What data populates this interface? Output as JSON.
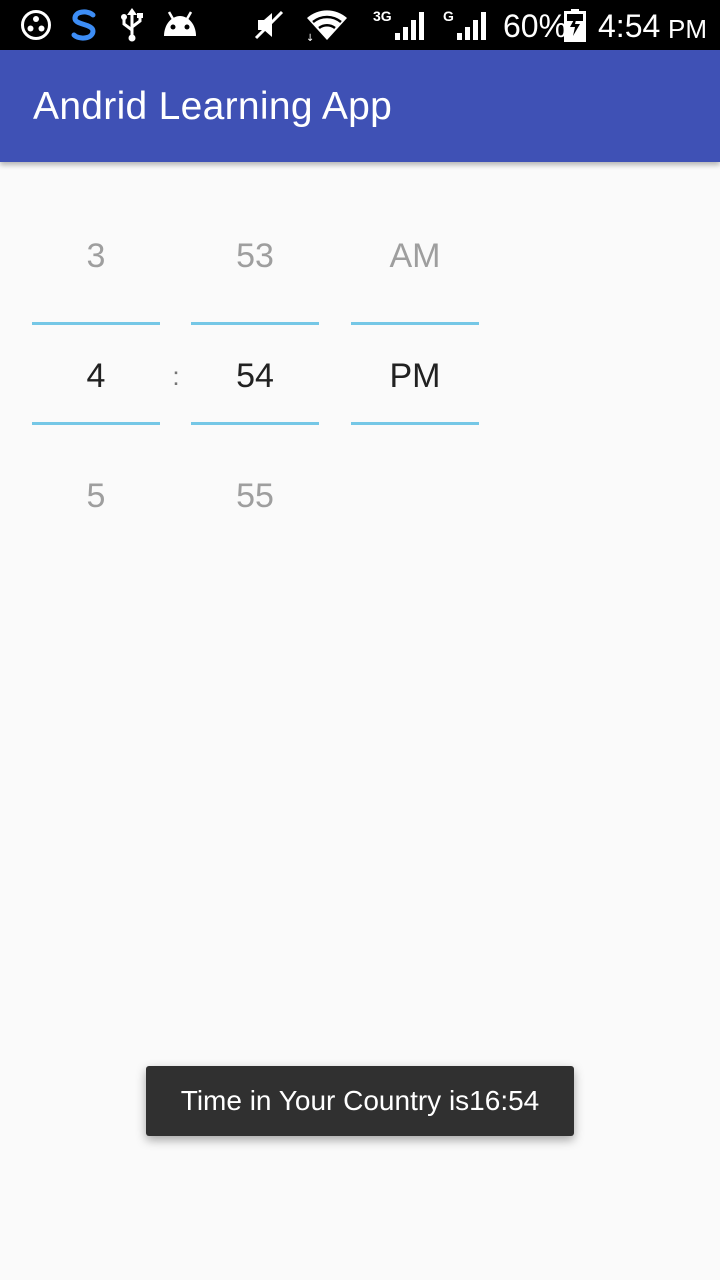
{
  "status_bar": {
    "network_3g": "3G",
    "network_g": "G",
    "battery": "60%",
    "clock": "4:54",
    "clock_ampm": "PM",
    "icons": [
      "dots-icon",
      "s-app-icon",
      "usb-icon",
      "android-icon",
      "mute-icon",
      "wifi-icon",
      "signal-3g-icon",
      "signal-g-icon",
      "battery-charging-icon"
    ]
  },
  "app_bar": {
    "title": "Andrid Learning App",
    "color": "#3f51b5"
  },
  "time_picker": {
    "hour": {
      "prev": "3",
      "current": "4",
      "next": "5"
    },
    "separator": ":",
    "minute": {
      "prev": "53",
      "current": "54",
      "next": "55"
    },
    "ampm": {
      "prev": "AM",
      "current": "PM"
    },
    "divider_color": "#75c7e6"
  },
  "toast": {
    "message": "Time in Your Country is16:54"
  }
}
